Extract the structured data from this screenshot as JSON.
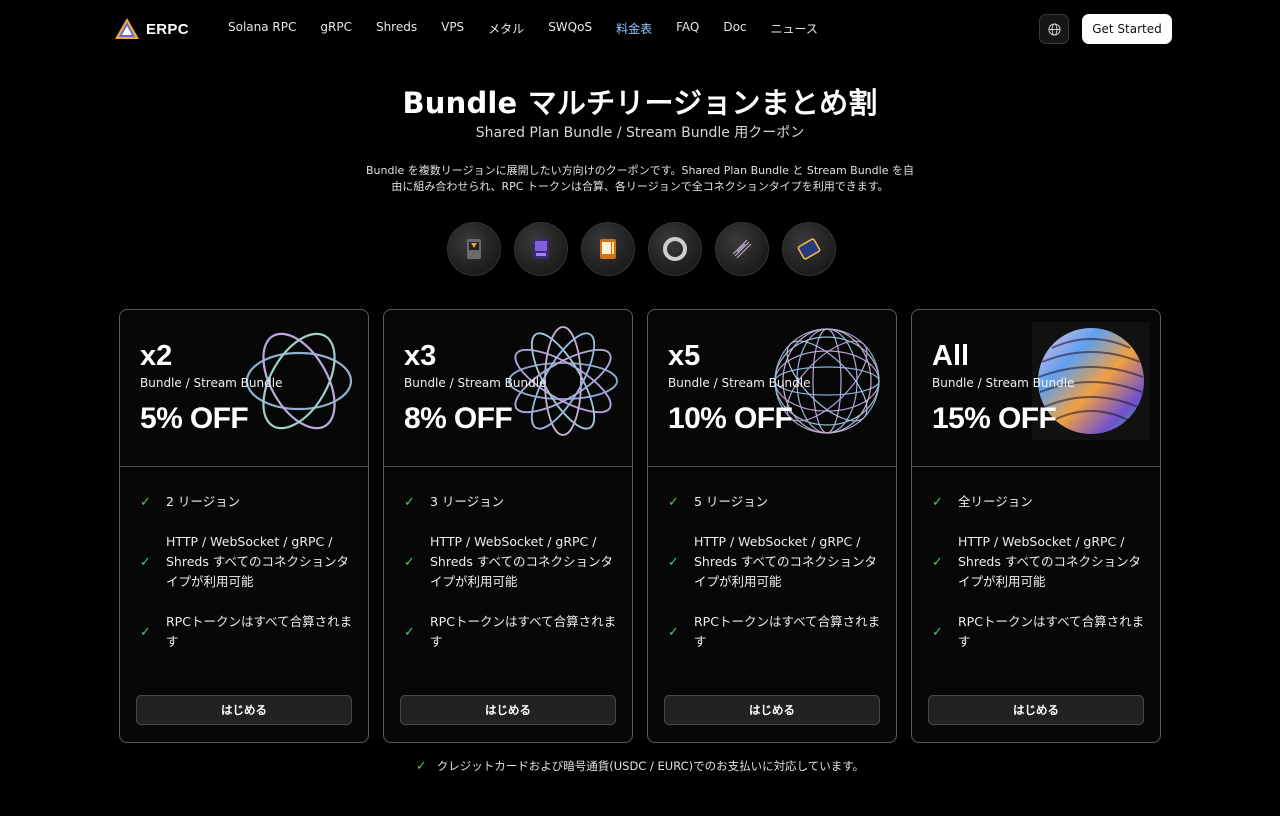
{
  "brand": {
    "name": "ERPC"
  },
  "nav": {
    "links": [
      "Solana RPC",
      "gRPC",
      "Shreds",
      "VPS",
      "メタル",
      "SWQoS",
      "料金表",
      "FAQ",
      "Doc",
      "ニュース"
    ],
    "active_index": 6,
    "cta": "Get Started"
  },
  "hero": {
    "title": "Bundle マルチリージョンまとめ割",
    "subtitle": "Shared Plan Bundle / Stream Bundle 用クーポン",
    "description_line1": "Bundle を複数リージョンに展開したい方向けのクーポンです。Shared Plan Bundle と Stream Bundle を自",
    "description_line2": "由に組み合わせられ、RPC トークンは合算、各リージョンで全コネクションタイプを利用できます。"
  },
  "cards": [
    {
      "multiplier": "x2",
      "plan": "Bundle / Stream Bundle",
      "discount": "5% OFF",
      "features": [
        "2 リージョン",
        "HTTP / WebSocket / gRPC / Shreds すべてのコネクションタイプが利用可能",
        "RPCトークンはすべて合算されます"
      ],
      "button": "はじめる"
    },
    {
      "multiplier": "x3",
      "plan": "Bundle / Stream Bundle",
      "discount": "8% OFF",
      "features": [
        "3 リージョン",
        "HTTP / WebSocket / gRPC / Shreds すべてのコネクションタイプが利用可能",
        "RPCトークンはすべて合算されます"
      ],
      "button": "はじめる"
    },
    {
      "multiplier": "x5",
      "plan": "Bundle / Stream Bundle",
      "discount": "10% OFF",
      "features": [
        "5 リージョン",
        "HTTP / WebSocket / gRPC / Shreds すべてのコネクションタイプが利用可能",
        "RPCトークンはすべて合算されます"
      ],
      "button": "はじめる"
    },
    {
      "multiplier": "All",
      "plan": "Bundle / Stream Bundle",
      "discount": "15% OFF",
      "features": [
        "全リージョン",
        "HTTP / WebSocket / gRPC / Shreds すべてのコネクションタイプが利用可能",
        "RPCトークンはすべて合算されます"
      ],
      "button": "はじめる"
    }
  ],
  "footer_note": "クレジットカードおよび暗号通貨(USDC / EURC)でのお支払いに対応しています。",
  "colors": {
    "accent_nav": "#8fc8ff",
    "check": "#3ecf6a",
    "background": "#000000"
  }
}
